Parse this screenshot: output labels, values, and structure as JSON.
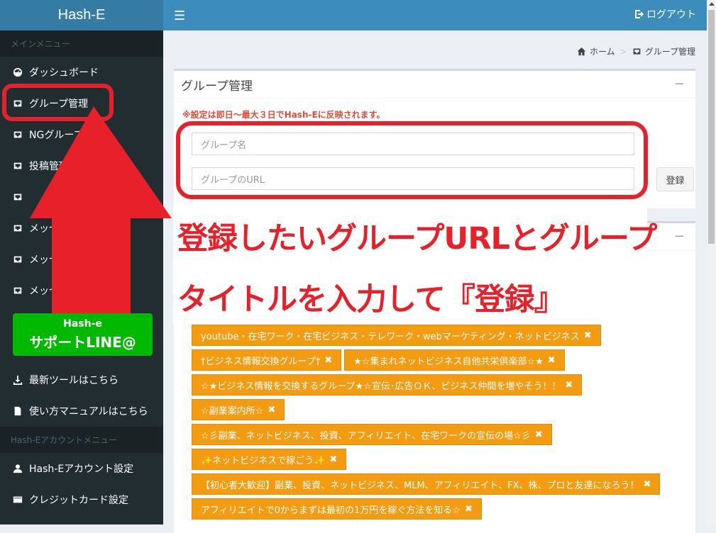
{
  "app": {
    "logo": "Hash-E"
  },
  "topbar": {
    "menu_icon": "☰",
    "logout_label": "ログアウト"
  },
  "sidebar": {
    "main_header": "メインメニュー",
    "items": [
      {
        "label": "ダッシュボード",
        "icon": "dashboard-icon"
      },
      {
        "label": "グループ管理",
        "icon": "inbox-icon"
      },
      {
        "label": "NGグループ管理",
        "icon": "inbox-icon"
      },
      {
        "label": "投稿管理",
        "icon": "inbox-icon"
      },
      {
        "label": "",
        "icon": "inbox-icon"
      },
      {
        "label": "メッセージ送信(略目)",
        "icon": "inbox-icon"
      },
      {
        "label": "メッセージ送信(略目)",
        "icon": "inbox-icon"
      },
      {
        "label": "メッセージ",
        "icon": "inbox-icon"
      }
    ],
    "line_badge": {
      "line1": "Hash-e",
      "line2": "サポートLINE@"
    },
    "extra_items": [
      {
        "label": "最新ツールはこちら",
        "icon": "download-icon"
      },
      {
        "label": "使い方マニュアルはこちら",
        "icon": "file-icon"
      }
    ],
    "account_header": "Hash-Eアカウントメニュー",
    "account_items": [
      {
        "label": "Hash-Eアカウント設定",
        "icon": "user-icon"
      },
      {
        "label": "クレジットカード設定",
        "icon": "credit-card-icon"
      }
    ]
  },
  "breadcrumb": {
    "home": "ホーム",
    "current": "グループ管理"
  },
  "group_box": {
    "title": "グループ管理",
    "collapse": "−",
    "notice": "※設定は即日～最大３日でHash-Eに反映されます。",
    "name_placeholder": "グループ名",
    "url_placeholder": "グループのURL",
    "register_label": "登録"
  },
  "list_box": {
    "collapse": "−",
    "tags": [
      "youtube・在宅ワーク・在宅ビジネス・テレワーク・webマーケティング・ネットビジネス",
      "†ビジネス情報交換グループ†",
      "★☆集まれネットビジネス自他共栄倶楽部☆★",
      "☆★ビジネス情報を交換するグループ★☆宣伝･広告ＯＫ、ビジネス仲間を増やそう！！",
      "☆副業案内所☆",
      "☆彡副業、ネットビジネス、投資、アフィリエイト、在宅ワークの宣伝の場☆彡",
      "✨ネットビジネスで稼ごう✨",
      "【初心者大歓迎】副業、投資、ネットビジネス、MLM、アフィリエイト、FX、株、プロと友達になろう！",
      "アフィリエイトで0からまずは最初の1万円を稼ぐ方法を知る☆"
    ],
    "remove_glyph": "✖"
  },
  "annotation": {
    "line1": "登録したいグループURLとグループ",
    "line2": "タイトルを入力して『登録』"
  },
  "colors": {
    "accent": "#3c8dbc",
    "sidebar": "#222d32",
    "tag": "#f39c12",
    "highlight": "#e8202a",
    "line": "#00b900"
  }
}
